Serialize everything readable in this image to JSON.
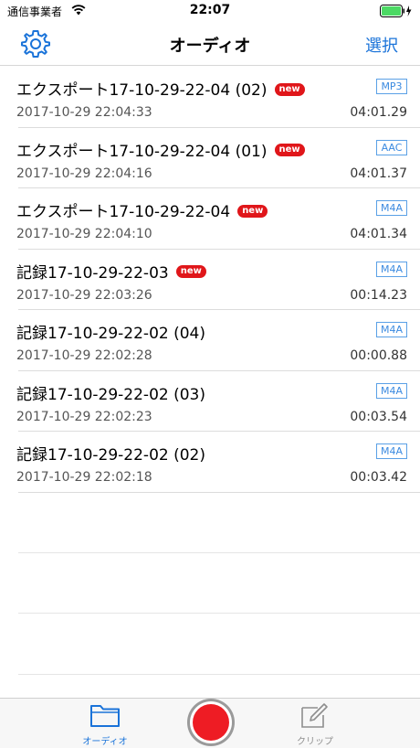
{
  "status_bar": {
    "carrier": "通信事業者",
    "time": "22:07",
    "battery_color": "#4cd964"
  },
  "nav": {
    "title": "オーディオ",
    "select_label": "選択",
    "settings_icon": "gear-icon"
  },
  "colors": {
    "accent": "#1a73d9",
    "new_badge": "#e0161a",
    "record": "#ee1c24"
  },
  "recordings": [
    {
      "name": "エクスポート17-10-29-22-04 (02)",
      "is_new": true,
      "badge": "new",
      "format": "MP3",
      "date": "2017-10-29 22:04:33",
      "duration": "04:01.29"
    },
    {
      "name": "エクスポート17-10-29-22-04 (01)",
      "is_new": true,
      "badge": "new",
      "format": "AAC",
      "date": "2017-10-29 22:04:16",
      "duration": "04:01.37"
    },
    {
      "name": "エクスポート17-10-29-22-04",
      "is_new": true,
      "badge": "new",
      "format": "M4A",
      "date": "2017-10-29 22:04:10",
      "duration": "04:01.34"
    },
    {
      "name": "記録17-10-29-22-03",
      "is_new": true,
      "badge": "new",
      "format": "M4A",
      "date": "2017-10-29 22:03:26",
      "duration": "00:14.23"
    },
    {
      "name": "記録17-10-29-22-02 (04)",
      "is_new": false,
      "format": "M4A",
      "date": "2017-10-29 22:02:28",
      "duration": "00:00.88"
    },
    {
      "name": "記録17-10-29-22-02 (03)",
      "is_new": false,
      "format": "M4A",
      "date": "2017-10-29 22:02:23",
      "duration": "00:03.54"
    },
    {
      "name": "記録17-10-29-22-02 (02)",
      "is_new": false,
      "format": "M4A",
      "date": "2017-10-29 22:02:18",
      "duration": "00:03.42"
    }
  ],
  "tabbar": {
    "audio_label": "オーディオ",
    "audio_icon": "folder-icon",
    "record_icon": "record-icon",
    "clip_label": "クリップ",
    "clip_icon": "edit-icon"
  }
}
